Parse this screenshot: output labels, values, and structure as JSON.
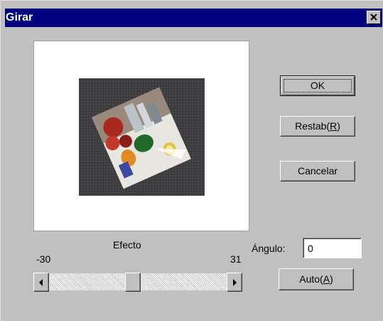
{
  "window": {
    "title": "Girar"
  },
  "buttons": {
    "ok": "OK",
    "reset_prefix": "Restab(",
    "reset_mnemonic": "R",
    "reset_suffix": ")",
    "cancel": "Cancelar",
    "auto_prefix": "Auto(",
    "auto_mnemonic": "A",
    "auto_suffix": ")"
  },
  "effect": {
    "label": "Efecto",
    "min_label": "-30",
    "max_label": "31",
    "slider_position": 0.47
  },
  "angle": {
    "label": "Ángulo:",
    "value": "0"
  },
  "icons": {
    "close": "close-icon",
    "scroll_left": "arrow-left-icon",
    "scroll_right": "arrow-right-icon"
  },
  "colors": {
    "titlebar": "#000080",
    "face": "#c0c0c0"
  }
}
